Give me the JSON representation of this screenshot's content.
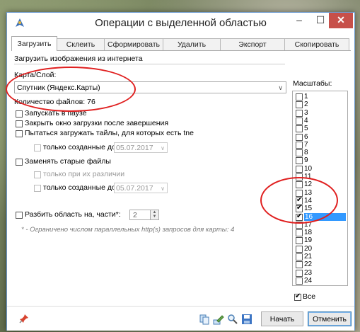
{
  "window": {
    "title": "Операции с выделенной областью",
    "minimize": "–",
    "maximize": "☐",
    "close": "✕"
  },
  "tabs": [
    {
      "label": "Загрузить",
      "active": true
    },
    {
      "label": "Склеить"
    },
    {
      "label": "Сформировать"
    },
    {
      "label": "Удалить"
    },
    {
      "label": "Экспорт"
    },
    {
      "label": "Скопировать"
    }
  ],
  "download": {
    "section_title": "Загрузить изображения из интернета",
    "map_layer_label": "Карта/Слой:",
    "map_layer_value": "Спутник (Яндекс.Карты)",
    "file_count": "Количество файлов: 76",
    "start_paused": "Запускать в паузе",
    "close_after_finish": "Закрыть окно загрузки после завершения",
    "try_load_tne": "Пытаться загружать тайлы, для которых есть tne",
    "only_created_before": "только созданные до",
    "date1": "05.07.2017",
    "replace_old": "Заменять старые файлы",
    "only_if_diff": "только при их различии",
    "date2": "05.07.2017",
    "split_area": "Разбить область на, части*:",
    "split_value": "2",
    "note": "* - Ограничено числом параллельных http(s) запросов для карты: 4"
  },
  "scales": {
    "title": "Масштабы:",
    "items": [
      {
        "n": "1",
        "checked": false
      },
      {
        "n": "2",
        "checked": false
      },
      {
        "n": "3",
        "checked": false
      },
      {
        "n": "4",
        "checked": false
      },
      {
        "n": "5",
        "checked": false
      },
      {
        "n": "6",
        "checked": false
      },
      {
        "n": "7",
        "checked": false
      },
      {
        "n": "8",
        "checked": false
      },
      {
        "n": "9",
        "checked": false
      },
      {
        "n": "10",
        "checked": false
      },
      {
        "n": "11",
        "checked": false
      },
      {
        "n": "12",
        "checked": false
      },
      {
        "n": "13",
        "checked": false
      },
      {
        "n": "14",
        "checked": true
      },
      {
        "n": "15",
        "checked": true
      },
      {
        "n": "16",
        "checked": true,
        "selected": true
      },
      {
        "n": "17",
        "checked": false
      },
      {
        "n": "18",
        "checked": false
      },
      {
        "n": "19",
        "checked": false
      },
      {
        "n": "20",
        "checked": false
      },
      {
        "n": "21",
        "checked": false
      },
      {
        "n": "22",
        "checked": false
      },
      {
        "n": "23",
        "checked": false
      },
      {
        "n": "24",
        "checked": false
      }
    ],
    "all_label": "Все"
  },
  "buttons": {
    "start": "Начать",
    "cancel": "Отменить"
  },
  "colors": {
    "annotation": "#e02020",
    "selection": "#3399ff",
    "close_button": "#c7504a"
  }
}
